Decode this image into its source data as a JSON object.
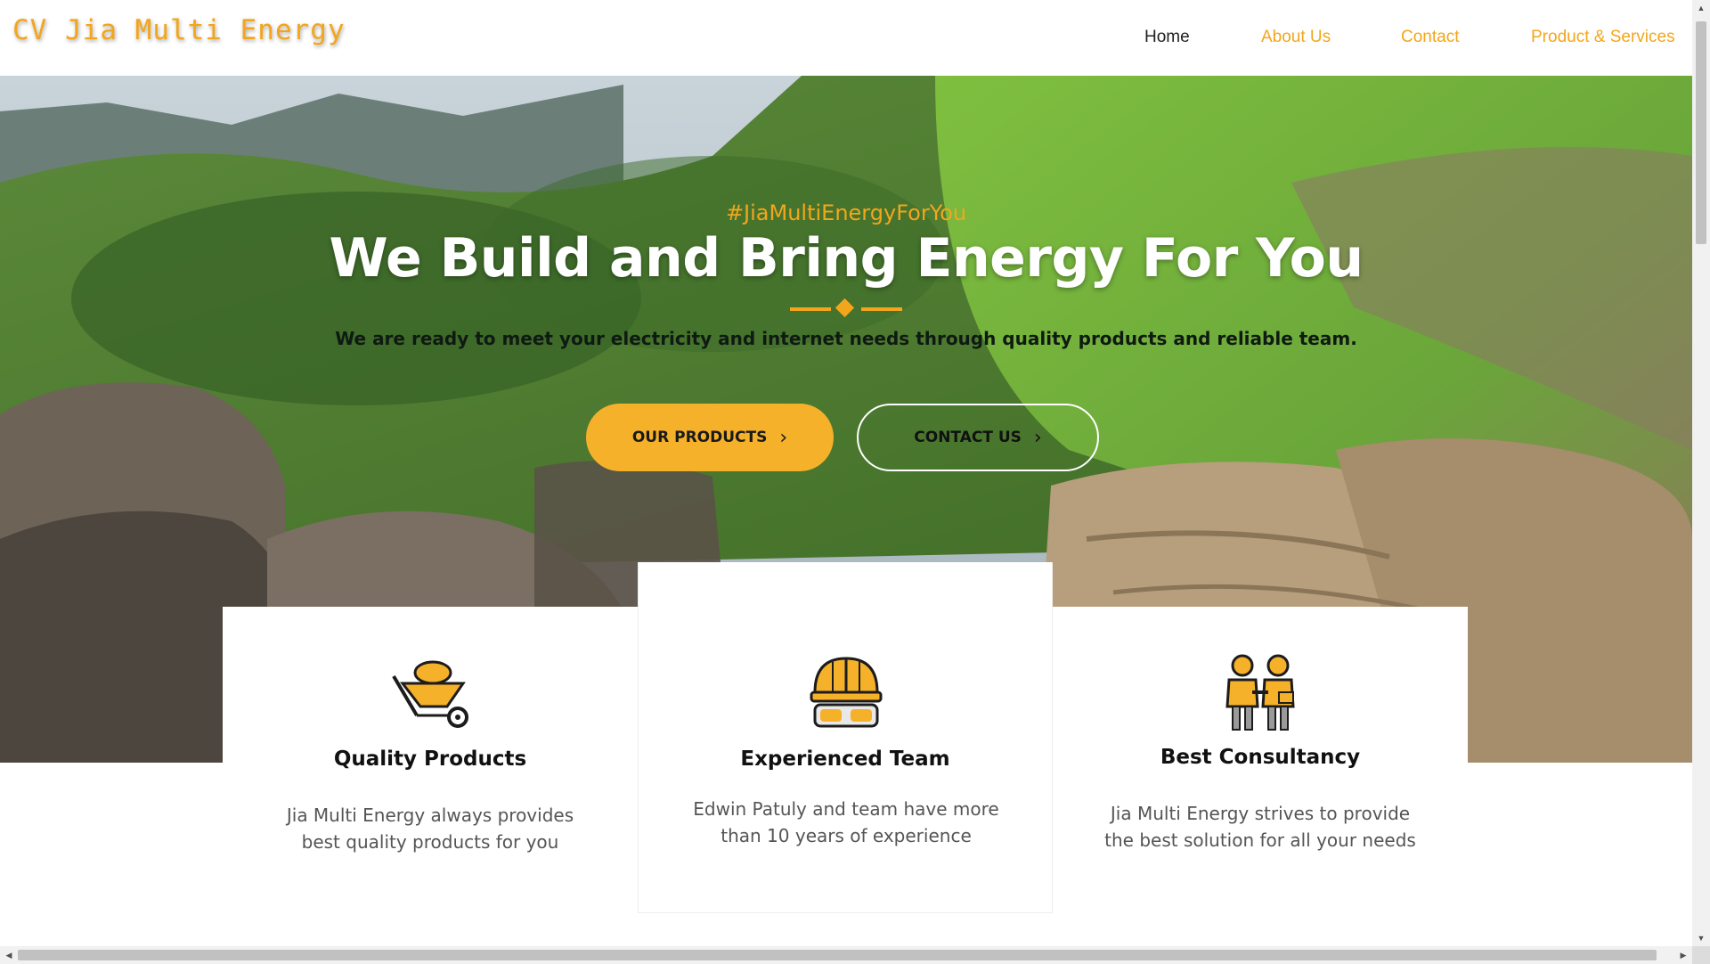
{
  "header": {
    "logo": "CV Jia Multi Energy",
    "nav": [
      {
        "label": "Home",
        "active": true
      },
      {
        "label": "About Us",
        "active": false
      },
      {
        "label": "Contact",
        "active": false
      },
      {
        "label": "Product & Services",
        "active": false
      }
    ]
  },
  "hero": {
    "tagline": "#JiaMultiEnergyForYou",
    "headline": "We Build and Bring Energy For You",
    "subline": "We are ready to meet your electricity and internet needs through quality products and reliable team.",
    "primary_button": "OUR PRODUCTS",
    "secondary_button": "CONTACT US",
    "button_icon": "chevron-right-icon"
  },
  "features": [
    {
      "icon": "wheelbarrow-icon",
      "title": "Quality Products",
      "text": "Jia Multi Energy always provides best quality products for you"
    },
    {
      "icon": "hard-hat-goggles-icon",
      "title": "Experienced Team",
      "text": "Edwin Patuly and team have more than 10 years of experience"
    },
    {
      "icon": "handshake-people-icon",
      "title": "Best Consultancy",
      "text": "Jia Multi Energy strives to provide the best solution for all your needs"
    }
  ],
  "colors": {
    "accent": "#f3a61b",
    "button": "#f6b12a"
  }
}
